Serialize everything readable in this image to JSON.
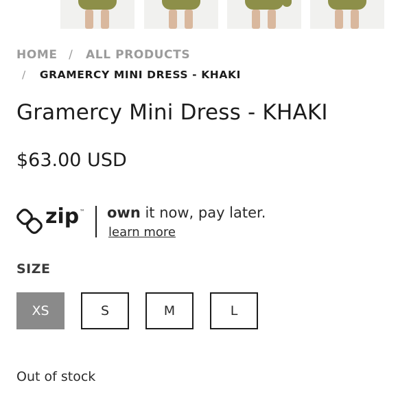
{
  "breadcrumb": {
    "home": "HOME",
    "separator": "/",
    "all_products": "ALL PRODUCTS",
    "current": "GRAMERCY MINI DRESS - KHAKI"
  },
  "product": {
    "title": "Gramercy Mini Dress - KHAKI",
    "price": "$63.00 USD",
    "accent_color": "#8d8f49"
  },
  "zip": {
    "brand": "zip",
    "tm": "™",
    "tagline_bold": "own",
    "tagline_rest": " it now, pay later.",
    "learn_more": "learn more",
    "logo_icon": "zip-logo-icon"
  },
  "size": {
    "label": "SIZE",
    "options": [
      "XS",
      "S",
      "M",
      "L"
    ],
    "selected": "XS"
  },
  "stock_status": "Out of stock"
}
